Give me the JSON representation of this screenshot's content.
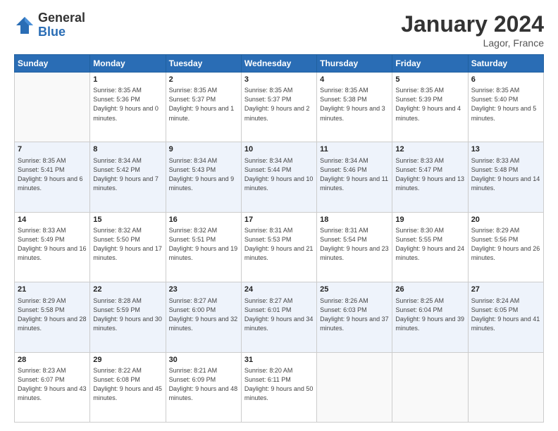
{
  "header": {
    "logo_general": "General",
    "logo_blue": "Blue",
    "month_title": "January 2024",
    "location": "Lagor, France"
  },
  "days_of_week": [
    "Sunday",
    "Monday",
    "Tuesday",
    "Wednesday",
    "Thursday",
    "Friday",
    "Saturday"
  ],
  "weeks": [
    [
      {
        "day": "",
        "sunrise": "",
        "sunset": "",
        "daylight": ""
      },
      {
        "day": "1",
        "sunrise": "Sunrise: 8:35 AM",
        "sunset": "Sunset: 5:36 PM",
        "daylight": "Daylight: 9 hours and 0 minutes."
      },
      {
        "day": "2",
        "sunrise": "Sunrise: 8:35 AM",
        "sunset": "Sunset: 5:37 PM",
        "daylight": "Daylight: 9 hours and 1 minute."
      },
      {
        "day": "3",
        "sunrise": "Sunrise: 8:35 AM",
        "sunset": "Sunset: 5:37 PM",
        "daylight": "Daylight: 9 hours and 2 minutes."
      },
      {
        "day": "4",
        "sunrise": "Sunrise: 8:35 AM",
        "sunset": "Sunset: 5:38 PM",
        "daylight": "Daylight: 9 hours and 3 minutes."
      },
      {
        "day": "5",
        "sunrise": "Sunrise: 8:35 AM",
        "sunset": "Sunset: 5:39 PM",
        "daylight": "Daylight: 9 hours and 4 minutes."
      },
      {
        "day": "6",
        "sunrise": "Sunrise: 8:35 AM",
        "sunset": "Sunset: 5:40 PM",
        "daylight": "Daylight: 9 hours and 5 minutes."
      }
    ],
    [
      {
        "day": "7",
        "sunrise": "Sunrise: 8:35 AM",
        "sunset": "Sunset: 5:41 PM",
        "daylight": "Daylight: 9 hours and 6 minutes."
      },
      {
        "day": "8",
        "sunrise": "Sunrise: 8:34 AM",
        "sunset": "Sunset: 5:42 PM",
        "daylight": "Daylight: 9 hours and 7 minutes."
      },
      {
        "day": "9",
        "sunrise": "Sunrise: 8:34 AM",
        "sunset": "Sunset: 5:43 PM",
        "daylight": "Daylight: 9 hours and 9 minutes."
      },
      {
        "day": "10",
        "sunrise": "Sunrise: 8:34 AM",
        "sunset": "Sunset: 5:44 PM",
        "daylight": "Daylight: 9 hours and 10 minutes."
      },
      {
        "day": "11",
        "sunrise": "Sunrise: 8:34 AM",
        "sunset": "Sunset: 5:46 PM",
        "daylight": "Daylight: 9 hours and 11 minutes."
      },
      {
        "day": "12",
        "sunrise": "Sunrise: 8:33 AM",
        "sunset": "Sunset: 5:47 PM",
        "daylight": "Daylight: 9 hours and 13 minutes."
      },
      {
        "day": "13",
        "sunrise": "Sunrise: 8:33 AM",
        "sunset": "Sunset: 5:48 PM",
        "daylight": "Daylight: 9 hours and 14 minutes."
      }
    ],
    [
      {
        "day": "14",
        "sunrise": "Sunrise: 8:33 AM",
        "sunset": "Sunset: 5:49 PM",
        "daylight": "Daylight: 9 hours and 16 minutes."
      },
      {
        "day": "15",
        "sunrise": "Sunrise: 8:32 AM",
        "sunset": "Sunset: 5:50 PM",
        "daylight": "Daylight: 9 hours and 17 minutes."
      },
      {
        "day": "16",
        "sunrise": "Sunrise: 8:32 AM",
        "sunset": "Sunset: 5:51 PM",
        "daylight": "Daylight: 9 hours and 19 minutes."
      },
      {
        "day": "17",
        "sunrise": "Sunrise: 8:31 AM",
        "sunset": "Sunset: 5:53 PM",
        "daylight": "Daylight: 9 hours and 21 minutes."
      },
      {
        "day": "18",
        "sunrise": "Sunrise: 8:31 AM",
        "sunset": "Sunset: 5:54 PM",
        "daylight": "Daylight: 9 hours and 23 minutes."
      },
      {
        "day": "19",
        "sunrise": "Sunrise: 8:30 AM",
        "sunset": "Sunset: 5:55 PM",
        "daylight": "Daylight: 9 hours and 24 minutes."
      },
      {
        "day": "20",
        "sunrise": "Sunrise: 8:29 AM",
        "sunset": "Sunset: 5:56 PM",
        "daylight": "Daylight: 9 hours and 26 minutes."
      }
    ],
    [
      {
        "day": "21",
        "sunrise": "Sunrise: 8:29 AM",
        "sunset": "Sunset: 5:58 PM",
        "daylight": "Daylight: 9 hours and 28 minutes."
      },
      {
        "day": "22",
        "sunrise": "Sunrise: 8:28 AM",
        "sunset": "Sunset: 5:59 PM",
        "daylight": "Daylight: 9 hours and 30 minutes."
      },
      {
        "day": "23",
        "sunrise": "Sunrise: 8:27 AM",
        "sunset": "Sunset: 6:00 PM",
        "daylight": "Daylight: 9 hours and 32 minutes."
      },
      {
        "day": "24",
        "sunrise": "Sunrise: 8:27 AM",
        "sunset": "Sunset: 6:01 PM",
        "daylight": "Daylight: 9 hours and 34 minutes."
      },
      {
        "day": "25",
        "sunrise": "Sunrise: 8:26 AM",
        "sunset": "Sunset: 6:03 PM",
        "daylight": "Daylight: 9 hours and 37 minutes."
      },
      {
        "day": "26",
        "sunrise": "Sunrise: 8:25 AM",
        "sunset": "Sunset: 6:04 PM",
        "daylight": "Daylight: 9 hours and 39 minutes."
      },
      {
        "day": "27",
        "sunrise": "Sunrise: 8:24 AM",
        "sunset": "Sunset: 6:05 PM",
        "daylight": "Daylight: 9 hours and 41 minutes."
      }
    ],
    [
      {
        "day": "28",
        "sunrise": "Sunrise: 8:23 AM",
        "sunset": "Sunset: 6:07 PM",
        "daylight": "Daylight: 9 hours and 43 minutes."
      },
      {
        "day": "29",
        "sunrise": "Sunrise: 8:22 AM",
        "sunset": "Sunset: 6:08 PM",
        "daylight": "Daylight: 9 hours and 45 minutes."
      },
      {
        "day": "30",
        "sunrise": "Sunrise: 8:21 AM",
        "sunset": "Sunset: 6:09 PM",
        "daylight": "Daylight: 9 hours and 48 minutes."
      },
      {
        "day": "31",
        "sunrise": "Sunrise: 8:20 AM",
        "sunset": "Sunset: 6:11 PM",
        "daylight": "Daylight: 9 hours and 50 minutes."
      },
      {
        "day": "",
        "sunrise": "",
        "sunset": "",
        "daylight": ""
      },
      {
        "day": "",
        "sunrise": "",
        "sunset": "",
        "daylight": ""
      },
      {
        "day": "",
        "sunrise": "",
        "sunset": "",
        "daylight": ""
      }
    ]
  ]
}
